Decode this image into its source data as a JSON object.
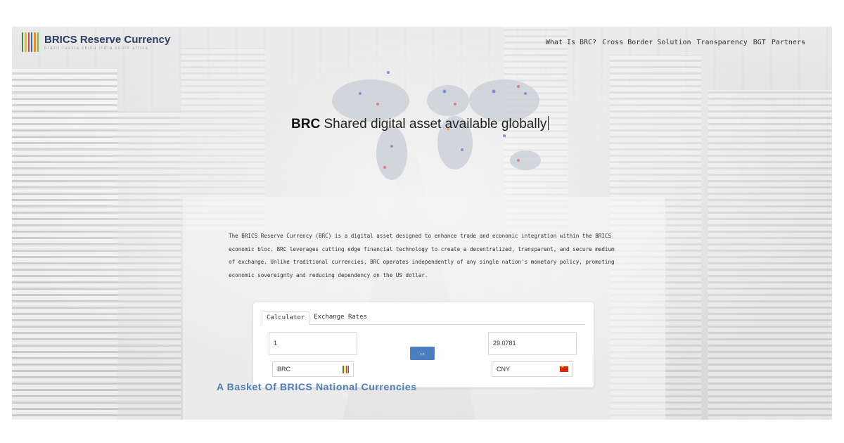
{
  "brand": {
    "title": "BRICS Reserve Currency",
    "subtitle": "brazil russia china india south africa",
    "logo_colors": [
      "#3a8d3f",
      "#f2b632",
      "#d6473a",
      "#2f6db5",
      "#f08a24",
      "#6fbf4a"
    ]
  },
  "nav": {
    "items": [
      "What Is BRC?",
      "Cross Border Solution",
      "Transparency",
      "BGT",
      "Partners"
    ]
  },
  "hero": {
    "bold": "BRC",
    "text": " Shared digital asset available globally"
  },
  "intro": {
    "text": "The BRICS Reserve Currency (BRC) is a digital asset designed to enhance trade and economic integration within the BRICS economic bloc. BRC leverages cutting edge financial technology to create a decentralized, transparent, and secure medium of exchange. Unlike traditional currencies, BRC operates independently of any single nation's monetary policy, promoting economic sovereignty and reducing dependency on the US dollar."
  },
  "calculator": {
    "tabs": [
      "Calculator",
      "Exchange Rates"
    ],
    "active_tab": "Calculator",
    "from_amount": "1",
    "to_amount": "29.0781",
    "from_currency": "BRC",
    "to_currency": "CNY",
    "swap_label": "↔"
  },
  "section": {
    "heading": "A Basket Of BRICS National Currencies"
  },
  "colors": {
    "accent": "#4a7fc1",
    "heading": "#4f7db5",
    "brand_text": "#2b3d64"
  }
}
